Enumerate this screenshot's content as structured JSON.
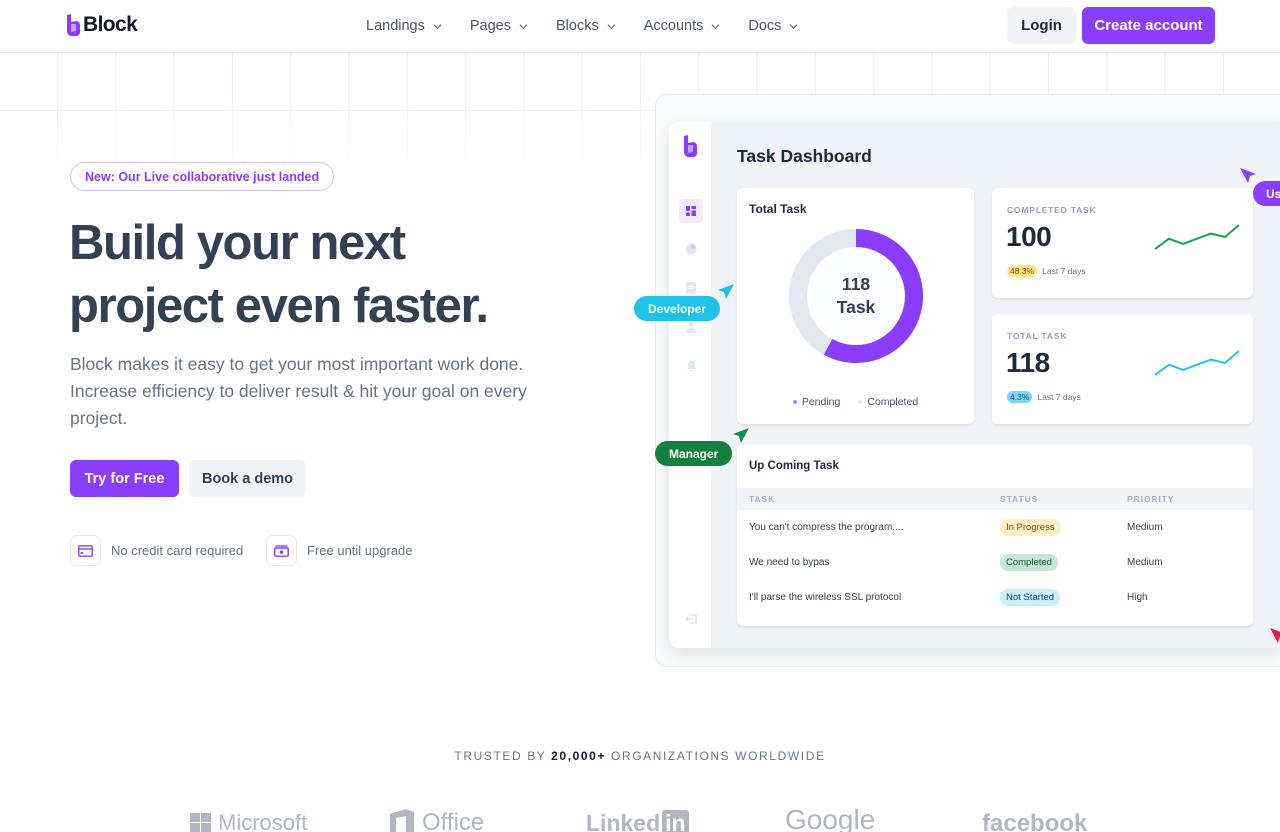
{
  "header": {
    "brand": "Block",
    "nav": [
      {
        "label": "Landings"
      },
      {
        "label": "Pages"
      },
      {
        "label": "Blocks"
      },
      {
        "label": "Accounts"
      },
      {
        "label": "Docs"
      }
    ],
    "login_label": "Login",
    "create_label": "Create account"
  },
  "hero": {
    "badge": "New: Our Live collaborative just landed",
    "title_line1": "Build your next",
    "title_line2": "project even faster.",
    "description": "Block makes it easy to get your most important work done. Increase efficiency to deliver result & hit your goal on every project.",
    "try_label": "Try for Free",
    "demo_label": "Book a demo",
    "perks": [
      {
        "icon": "credit-card-icon",
        "label": "No credit card required"
      },
      {
        "icon": "cash-icon",
        "label": "Free until upgrade"
      }
    ]
  },
  "dashboard": {
    "title": "Task Dashboard",
    "total_card": {
      "title": "Total Task",
      "center_value": "118",
      "center_unit": "Task",
      "completed_fraction": 0.58,
      "legend": [
        {
          "label": "Pending",
          "color": "#8b3dff"
        },
        {
          "label": "Completed",
          "color": "#e2e8f0"
        }
      ]
    },
    "stats": [
      {
        "label": "COMPLETED TASK",
        "value": "100",
        "pct": "48.3%",
        "pct_bg": "#fde68a",
        "pct_color": "#92400e",
        "period": "Last 7 days",
        "line_color": "#16a34a",
        "trend": [
          2,
          5,
          3.5,
          5,
          6.5,
          5.5,
          9
        ]
      },
      {
        "label": "TOTAL TASK",
        "value": "118",
        "pct": "4.3%",
        "pct_bg": "#7dd3fc",
        "pct_color": "#075985",
        "period": "Last 7 days",
        "line_color": "#22c5e8",
        "trend": [
          2,
          5,
          3.5,
          5,
          6.5,
          5.5,
          9
        ]
      }
    ],
    "upcoming": {
      "title": "Up Coming Task",
      "columns": [
        "TASK",
        "STATUS",
        "PRIORITY"
      ],
      "rows": [
        {
          "task": "You can't compress the program....",
          "status": "In Progress",
          "status_bg": "#fdf0c2",
          "status_color": "#92400e",
          "priority": "Medium"
        },
        {
          "task": "We need to bypas",
          "status": "Completed",
          "status_bg": "#c6e6d6",
          "status_color": "#14532d",
          "priority": "Medium"
        },
        {
          "task": "I'll parse the wireless SSL protocol",
          "status": "Not Started",
          "status_bg": "#c8f0fc",
          "status_color": "#1e3a8a",
          "priority": "High"
        }
      ]
    },
    "cursors": [
      {
        "label": "Developer",
        "color": "#1ec3e7"
      },
      {
        "label": "Manager",
        "color": "#15803d"
      },
      {
        "label": "Us",
        "color": "#8b3dff"
      }
    ],
    "sidebar_icons": [
      "dashboard-icon",
      "pie-chart-icon",
      "document-icon",
      "users-icon",
      "bell-icon",
      "logout-icon"
    ]
  },
  "trusted": {
    "prefix": "TRUSTED BY ",
    "count": "20,000+",
    "suffix": " ORGANIZATIONS WORLDWIDE",
    "brands": [
      "Microsoft",
      "Office",
      "Linked",
      "Google",
      "facebook"
    ]
  }
}
